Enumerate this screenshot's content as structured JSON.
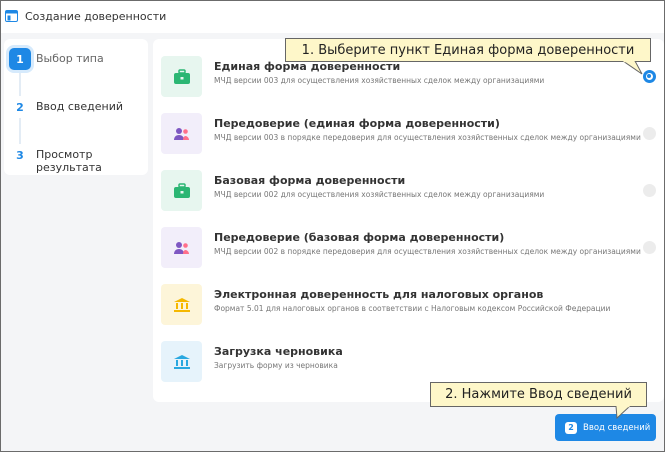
{
  "window": {
    "title": "Создание доверенности"
  },
  "steps": [
    {
      "number": "1",
      "label": "Выбор типа",
      "active": true
    },
    {
      "number": "2",
      "label": "Ввод сведений",
      "active": false
    },
    {
      "number": "3",
      "label": "Просмотр результата",
      "active": false
    }
  ],
  "options": [
    {
      "title": "Единая форма доверенности",
      "description": "МЧД версии 003 для осуществления хозяйственных сделок между организациями",
      "icon": "briefcase-icon",
      "selected": true
    },
    {
      "title": "Передоверие (единая форма доверенности)",
      "description": "МЧД версии 003 в порядке передоверия для осуществления хозяйственных сделок между организациями",
      "icon": "users-icon",
      "selected": false
    },
    {
      "title": "Базовая форма доверенности",
      "description": "МЧД версии 002 для осуществления хозяйственных сделок между организациями",
      "icon": "briefcase-icon",
      "selected": false
    },
    {
      "title": "Передоверие (базовая форма доверенности)",
      "description": "МЧД версии 002 в порядке передоверия для осуществления хозяйственных сделок между организациями",
      "icon": "users-icon",
      "selected": false
    },
    {
      "title": "Электронная доверенность для налоговых органов",
      "description": "Формат 5.01 для налоговых органов в соответствии с Налоговым кодексом Российской Федерации",
      "icon": "bank-icon",
      "selected": false
    },
    {
      "title": "Загрузка черновика",
      "description": "Загрузить форму из черновика",
      "icon": "bank-icon",
      "selected": false
    }
  ],
  "submit": {
    "badge": "2",
    "label": "Ввод сведений"
  },
  "callouts": {
    "first": "1. Выберите пункт Единая форма доверенности",
    "second": "2. Нажмите Ввод сведений"
  },
  "colors": {
    "accent": "#1e88e5",
    "callout_bg": "#fef7c9"
  }
}
